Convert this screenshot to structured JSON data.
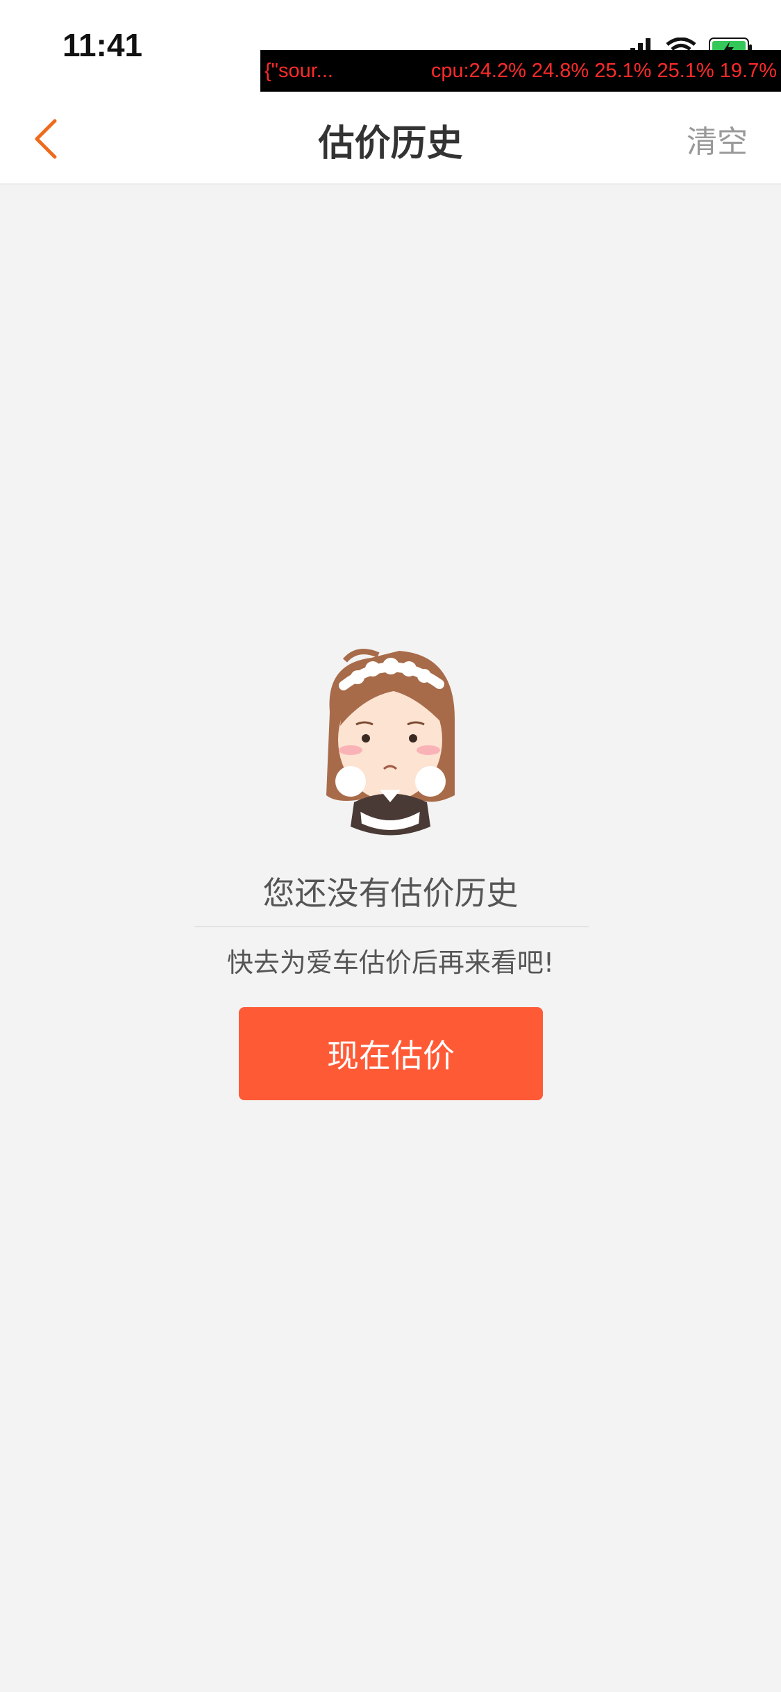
{
  "status_bar": {
    "time": "11:41"
  },
  "debug_overlay": {
    "source": "{\"sour...",
    "cpu": "cpu:24.2% 24.8% 25.1% 25.1% 19.7%"
  },
  "navbar": {
    "back_icon": "chevron-left-icon",
    "title": "估价历史",
    "clear_label": "清空"
  },
  "empty_state": {
    "title": "您还没有估价历史",
    "subtitle": "快去为爱车估价后再来看吧!",
    "button_label": "现在估价"
  },
  "colors": {
    "accent": "#ff5a36",
    "back_icon": "#f06a1c",
    "background": "#f3f3f3"
  }
}
